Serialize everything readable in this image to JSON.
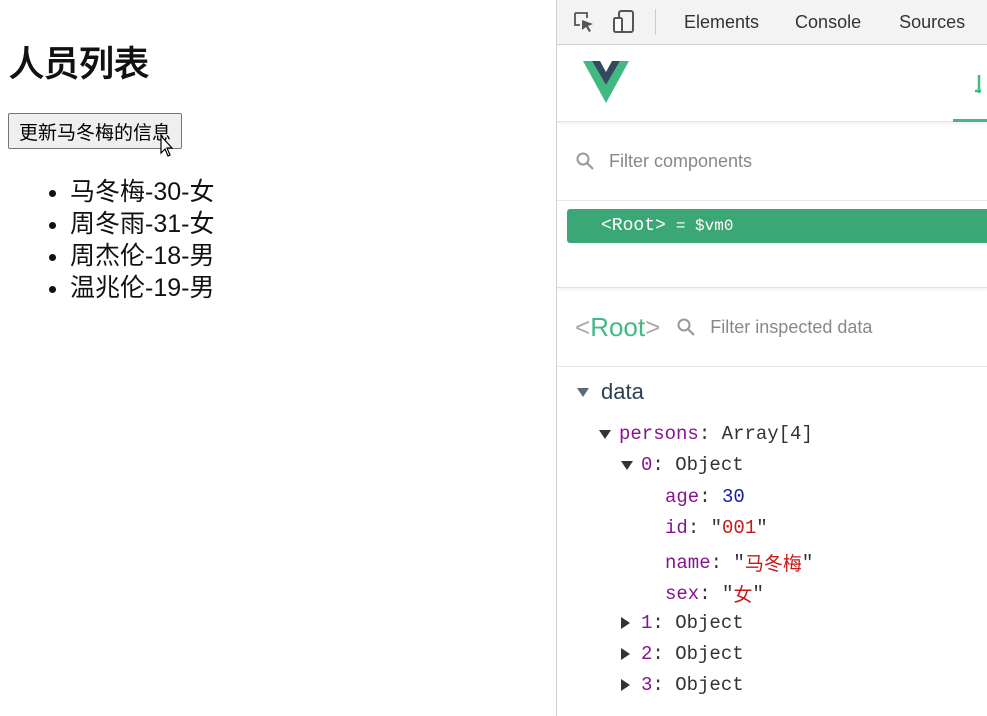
{
  "page": {
    "title": "人员列表",
    "update_button": "更新马冬梅的信息",
    "persons": [
      "马冬梅-30-女",
      "周冬雨-31-女",
      "周杰伦-18-男",
      "温兆伦-19-男"
    ]
  },
  "devtools": {
    "tabs": [
      "Elements",
      "Console",
      "Sources"
    ],
    "filter_components_placeholder": "Filter components",
    "root_component": {
      "tag": "<Root>",
      "eq": "= $vm0"
    },
    "inspector": {
      "title_open": "<",
      "title_name": "Root",
      "title_close": ">",
      "filter_placeholder": "Filter inspected data",
      "section": "data",
      "persons_key": "persons",
      "persons_type": "Array[4]",
      "item0": {
        "index": "0",
        "type": "Object",
        "fields": [
          {
            "key": "age",
            "value": "30",
            "kind": "num"
          },
          {
            "key": "id",
            "value": "001",
            "kind": "str"
          },
          {
            "key": "name",
            "value": "马冬梅",
            "kind": "str"
          },
          {
            "key": "sex",
            "value": "女",
            "kind": "str"
          }
        ]
      },
      "collapsed_items": [
        {
          "index": "1",
          "type": "Object"
        },
        {
          "index": "2",
          "type": "Object"
        },
        {
          "index": "3",
          "type": "Object"
        }
      ]
    }
  },
  "colors": {
    "vue_green": "#42b983",
    "root_row_bg": "#3ba776",
    "vue_dark": "#35495e"
  },
  "icons": [
    "inspect-element-icon",
    "device-toggle-icon",
    "vue-logo",
    "search-icon",
    "mouse-cursor-icon"
  ]
}
